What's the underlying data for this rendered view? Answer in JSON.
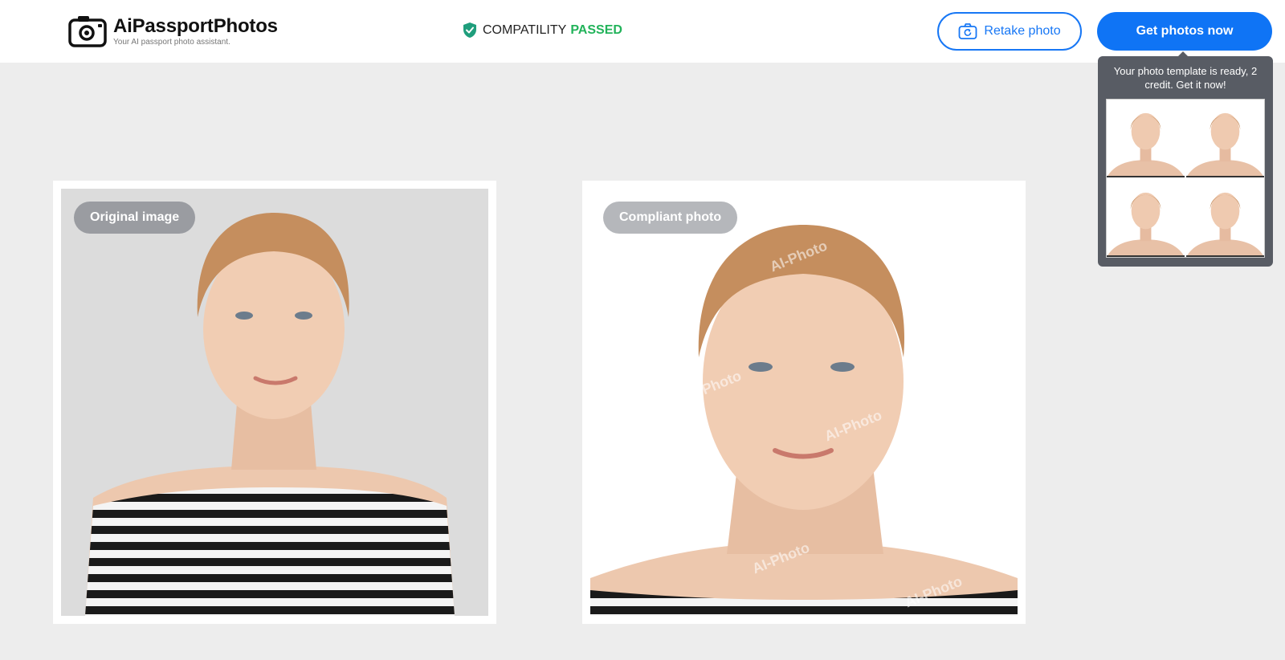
{
  "header": {
    "brand_name": "AiPassportPhotos",
    "brand_tagline": "Your AI passport photo assistant.",
    "compatibility_label": "COMPATILITY",
    "compatibility_status": "PASSED",
    "retake_label": "Retake photo",
    "get_photos_label": "Get photos now"
  },
  "popup": {
    "message": "Your photo template is ready, 2 credit. Get it now!"
  },
  "cards": {
    "original_label": "Original image",
    "compliant_label": "Compliant photo",
    "watermark": "AI-Photo"
  },
  "colors": {
    "accent": "#0f74f5",
    "passed": "#22b35a",
    "popup_bg": "#585c64",
    "page_bg": "#ededed"
  }
}
